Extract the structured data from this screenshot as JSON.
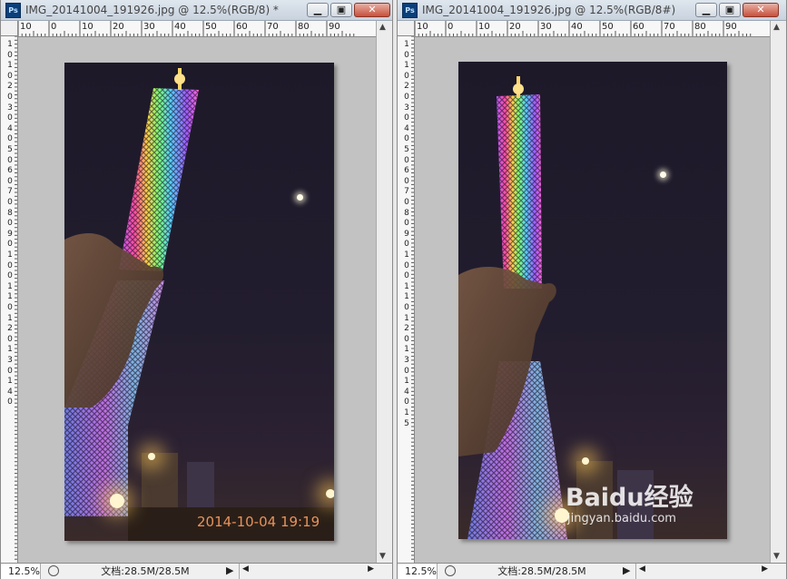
{
  "left_window": {
    "title": "IMG_20141004_191926.jpg @ 12.5%(RGB/8) *",
    "app_icon": "Ps",
    "controls": {
      "minimize": "minimize-icon",
      "restore": "restore-icon",
      "close": "close-icon"
    },
    "ruler_top_labels": [
      "10",
      "0",
      "10",
      "20",
      "30",
      "40",
      "50",
      "60",
      "70",
      "80",
      "90"
    ],
    "ruler_left_labels": [
      "1",
      "0",
      "1",
      "0",
      "2",
      "0",
      "3",
      "0",
      "4",
      "0",
      "5",
      "0",
      "6",
      "0",
      "7",
      "0",
      "8",
      "0",
      "9",
      "0",
      "1",
      "0",
      "0",
      "1",
      "1",
      "0",
      "1",
      "2",
      "0",
      "1",
      "3",
      "0",
      "1",
      "4",
      "0"
    ],
    "zoom": "12.5%",
    "doc_size": "文档:28.5M/28.5M",
    "date_stamp": "2014-10-04 19:19"
  },
  "right_window": {
    "title": "IMG_20141004_191926.jpg @ 12.5%(RGB/8#)",
    "app_icon": "Ps",
    "controls": {
      "minimize": "minimize-icon",
      "restore": "restore-icon",
      "close": "close-icon"
    },
    "ruler_top_labels": [
      "10",
      "0",
      "10",
      "20",
      "30",
      "40",
      "50",
      "60",
      "70",
      "80",
      "90"
    ],
    "ruler_left_labels": [
      "1",
      "0",
      "1",
      "0",
      "2",
      "0",
      "3",
      "0",
      "4",
      "0",
      "5",
      "0",
      "6",
      "0",
      "7",
      "0",
      "8",
      "0",
      "9",
      "0",
      "1",
      "0",
      "0",
      "1",
      "1",
      "0",
      "1",
      "2",
      "0",
      "1",
      "3",
      "0",
      "1",
      "4",
      "0",
      "1",
      "5"
    ],
    "zoom": "12.5%",
    "doc_size": "文档:28.5M/28.5M",
    "watermark_logo": "Baidu经验",
    "watermark_url": "jingyan.baidu.com"
  },
  "colors": {
    "canvas_gray": "#c2c2c2",
    "datestamp": "#e8925a",
    "titlebar": "#d3dbe4",
    "close_button": "#c84f3b"
  }
}
